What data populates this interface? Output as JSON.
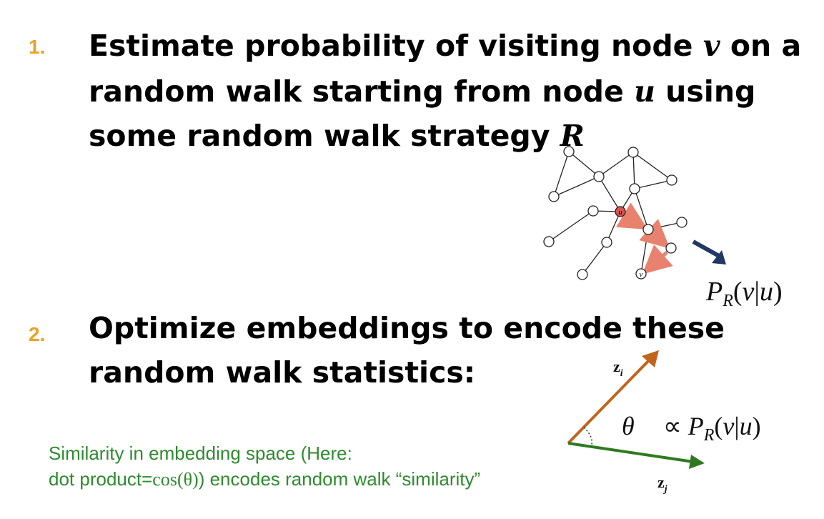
{
  "step1": {
    "number": "1.",
    "line1_pre": "Estimate probability of visiting node ",
    "line1_var": "v",
    "line1_post": " on a",
    "line2_pre": "random walk starting from node ",
    "line2_var": "u",
    "line2_post": " using",
    "line3_pre": "some random walk strategy ",
    "line3_var": "R"
  },
  "step2": {
    "number": "2.",
    "line1": "Optimize embeddings to encode these",
    "line2": "random walk statistics:"
  },
  "graph": {
    "start_label": "u",
    "end_label": "v",
    "probability_label": "P_R(v|u)"
  },
  "vectors": {
    "zi_label": "z_i",
    "zj_label": "z_j",
    "theta_label": "θ",
    "proportional_label": "∝ P_R(v|u)"
  },
  "note": {
    "line1": "Similarity in embedding space (Here:",
    "line2_pre": "dot product=",
    "line2_math": "cos(θ)",
    "line2_post": ") encodes random walk “similarity”"
  },
  "colors": {
    "number": "#e8a323",
    "note_text": "#2e8b2e",
    "walk_arrow": "#e8826f",
    "start_node": "#d9534f",
    "pointer_arrow": "#1f3864",
    "zi_arrow": "#c0651b",
    "zj_arrow": "#2f7a1f"
  }
}
